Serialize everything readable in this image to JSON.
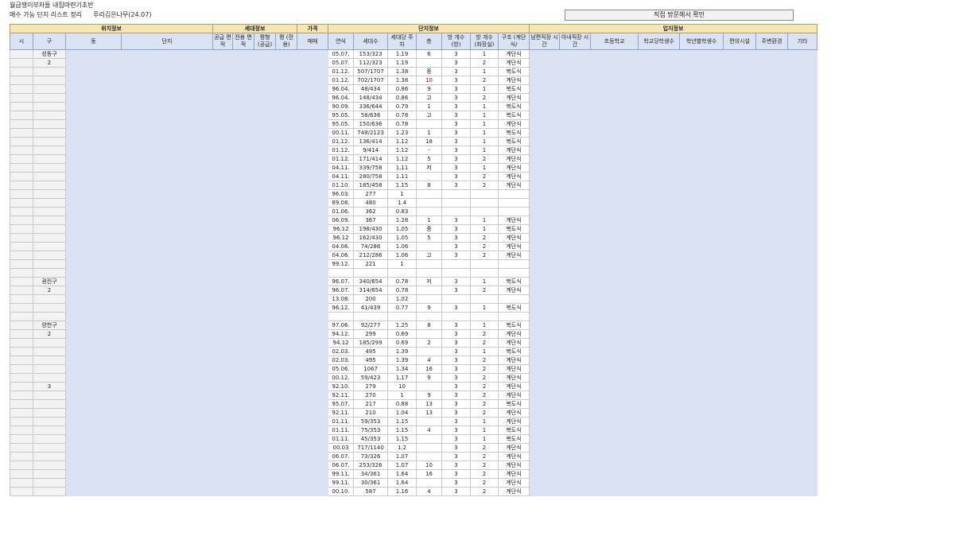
{
  "header": {
    "title": "월급쟁이부자들 내집마련기초반",
    "subtitle": "매수 가능 단지 리스트 정리",
    "author": "푸리김은나무(24.07)",
    "note": "직접 방문해서 확인"
  },
  "groups": [
    "위치정보",
    "세대정보",
    "가격",
    "단지정보",
    "입지정보"
  ],
  "columns": [
    "시",
    "구",
    "동",
    "단지",
    "공급 면적",
    "전용 면적",
    "평형 (공급)",
    "평 (전용)",
    "매매",
    "연식",
    "세대수",
    "세대당 주차",
    "층",
    "방 개수 (방)",
    "방 개수 (화장실)",
    "구조 (계단식/",
    "남편직장 시간",
    "아내직장 시간",
    "초등학교",
    "학교당학생수",
    "학년별학생수",
    "편의시설",
    "주변환경",
    "기타"
  ],
  "rows": [
    {
      "gu": "성동구",
      "year": "05.07.",
      "units": "153/323",
      "parking": "1.19",
      "floor": "6",
      "rooms": "3",
      "baths": "1",
      "structure": "계단식"
    },
    {
      "gu": "2",
      "year": "05.07.",
      "units": "112/323",
      "parking": "1.19",
      "floor": "",
      "rooms": "3",
      "baths": "2",
      "structure": "계단식"
    },
    {
      "gu": "",
      "year": "01.12.",
      "units": "507/1707",
      "parking": "1.38",
      "floor": "중",
      "rooms": "3",
      "baths": "1",
      "structure": "복도식"
    },
    {
      "gu": "",
      "year": "01.12.",
      "units": "702/1707",
      "parking": "1.38",
      "floor": "10",
      "rooms": "3",
      "baths": "2",
      "structure": "계단식",
      "red": true
    },
    {
      "gu": "",
      "year": "96.04.",
      "units": "48/434",
      "parking": "0.86",
      "floor": "9",
      "rooms": "3",
      "baths": "1",
      "structure": "복도식"
    },
    {
      "gu": "",
      "year": "96.04.",
      "units": "148/434",
      "parking": "0.86",
      "floor": "고",
      "rooms": "3",
      "baths": "2",
      "structure": "계단식"
    },
    {
      "gu": "",
      "year": "90.09.",
      "units": "336/644",
      "parking": "0.79",
      "floor": "1",
      "rooms": "3",
      "baths": "1",
      "structure": "복도식"
    },
    {
      "gu": "",
      "year": "95.05.",
      "units": "58/636",
      "parking": "0.78",
      "floor": "고",
      "rooms": "3",
      "baths": "1",
      "structure": "복도식"
    },
    {
      "gu": "",
      "year": "95.05.",
      "units": "150/636",
      "parking": "0.78",
      "floor": "",
      "rooms": "3",
      "baths": "1",
      "structure": "계단식"
    },
    {
      "gu": "",
      "year": "00.11.",
      "units": "748/2123",
      "parking": "1.23",
      "floor": "1",
      "rooms": "3",
      "baths": "1",
      "structure": "복도식"
    },
    {
      "gu": "",
      "year": "01.12.",
      "units": "136/414",
      "parking": "1.12",
      "floor": "18",
      "rooms": "3",
      "baths": "1",
      "structure": "복도식"
    },
    {
      "gu": "",
      "year": "01.12.",
      "units": "9/414",
      "parking": "1.12",
      "floor": "-",
      "rooms": "3",
      "baths": "1",
      "structure": "계단식"
    },
    {
      "gu": "",
      "year": "01.12.",
      "units": "171/414",
      "parking": "1.12",
      "floor": "5",
      "rooms": "3",
      "baths": "2",
      "structure": "계단식"
    },
    {
      "gu": "",
      "year": "04.11.",
      "units": "339/758",
      "parking": "1.11",
      "floor": "저",
      "rooms": "3",
      "baths": "1",
      "structure": "계단식"
    },
    {
      "gu": "",
      "year": "04.11.",
      "units": "280/758",
      "parking": "1.11",
      "floor": "",
      "rooms": "3",
      "baths": "2",
      "structure": "계단식"
    },
    {
      "gu": "",
      "year": "01.10.",
      "units": "185/458",
      "parking": "1.15",
      "floor": "8",
      "rooms": "3",
      "baths": "2",
      "structure": "계단식"
    },
    {
      "gu": "",
      "year": "96.03.",
      "units": "277",
      "parking": "1",
      "floor": "",
      "rooms": "",
      "baths": "",
      "structure": ""
    },
    {
      "gu": "",
      "year": "89.08.",
      "units": "480",
      "parking": "1.4",
      "floor": "",
      "rooms": "",
      "baths": "",
      "structure": ""
    },
    {
      "gu": "",
      "year": "01.06.",
      "units": "362",
      "parking": "0.83",
      "floor": "",
      "rooms": "",
      "baths": "",
      "structure": ""
    },
    {
      "gu": "",
      "year": "06.09.",
      "units": "367",
      "parking": "1.28",
      "floor": "1",
      "rooms": "3",
      "baths": "1",
      "structure": "계단식"
    },
    {
      "gu": "",
      "year": "96.12",
      "units": "198/430",
      "parking": "1.05",
      "floor": "중",
      "rooms": "3",
      "baths": "1",
      "structure": "복도식"
    },
    {
      "gu": "",
      "year": "96.12",
      "units": "162/430",
      "parking": "1.05",
      "floor": "5",
      "rooms": "3",
      "baths": "2",
      "structure": "계단식"
    },
    {
      "gu": "",
      "year": "04.06.",
      "units": "74/286",
      "parking": "1.06",
      "floor": "",
      "rooms": "3",
      "baths": "2",
      "structure": "계단식"
    },
    {
      "gu": "",
      "year": "04.06.",
      "units": "212/286",
      "parking": "1.06",
      "floor": "고",
      "rooms": "3",
      "baths": "2",
      "structure": "계단식"
    },
    {
      "gu": "",
      "year": "99.12.",
      "units": "221",
      "parking": "1",
      "floor": "",
      "rooms": "",
      "baths": "",
      "structure": ""
    },
    {
      "gu": "",
      "year": "",
      "units": "",
      "parking": "",
      "floor": "",
      "rooms": "",
      "baths": "",
      "structure": ""
    },
    {
      "gu": "광진구",
      "year": "96.07.",
      "units": "340/654",
      "parking": "0.78",
      "floor": "저",
      "rooms": "3",
      "baths": "1",
      "structure": "복도식"
    },
    {
      "gu": "2",
      "year": "96.07.",
      "units": "314/654",
      "parking": "0.78",
      "floor": "",
      "rooms": "3",
      "baths": "2",
      "structure": "계단식"
    },
    {
      "gu": "",
      "year": "13.08.",
      "units": "200",
      "parking": "1.02",
      "floor": "",
      "rooms": "",
      "baths": "",
      "structure": ""
    },
    {
      "gu": "",
      "year": "96.12.",
      "units": "41/439",
      "parking": "0.77",
      "floor": "9",
      "rooms": "3",
      "baths": "1",
      "structure": "복도식"
    },
    {
      "gu": "",
      "year": "",
      "units": "",
      "parking": "",
      "floor": "",
      "rooms": "",
      "baths": "",
      "structure": ""
    },
    {
      "gu": "양천구",
      "year": "97.06.",
      "units": "92/277",
      "parking": "1.25",
      "floor": "8",
      "rooms": "3",
      "baths": "1",
      "structure": "복도식"
    },
    {
      "gu": "2",
      "year": "94.12.",
      "units": "299",
      "parking": "0.69",
      "floor": "",
      "rooms": "3",
      "baths": "2",
      "structure": "계단식"
    },
    {
      "gu": "",
      "year": "94.12",
      "units": "185/299",
      "parking": "0.69",
      "floor": "2",
      "rooms": "3",
      "baths": "2",
      "structure": "계단식"
    },
    {
      "gu": "",
      "year": "02.03.",
      "units": "495",
      "parking": "1.39",
      "floor": "",
      "rooms": "3",
      "baths": "1",
      "structure": "복도식"
    },
    {
      "gu": "",
      "year": "02.03.",
      "units": "495",
      "parking": "1.39",
      "floor": "4",
      "rooms": "3",
      "baths": "2",
      "structure": "계단식"
    },
    {
      "gu": "",
      "year": "05.06.",
      "units": "1067",
      "parking": "1.34",
      "floor": "16",
      "rooms": "3",
      "baths": "2",
      "structure": "계단식"
    },
    {
      "gu": "",
      "year": "00.12.",
      "units": "59/423",
      "parking": "1.17",
      "floor": "9",
      "rooms": "3",
      "baths": "2",
      "structure": "계단식"
    },
    {
      "gu": "3",
      "year": "92.10.",
      "units": "279",
      "parking": "10",
      "floor": "",
      "rooms": "3",
      "baths": "2",
      "structure": "계단식"
    },
    {
      "gu": "",
      "year": "92.11.",
      "units": "270",
      "parking": "1",
      "floor": "9",
      "rooms": "3",
      "baths": "2",
      "structure": "계단식"
    },
    {
      "gu": "",
      "year": "95.07.",
      "units": "217",
      "parking": "0.88",
      "floor": "13",
      "rooms": "3",
      "baths": "2",
      "structure": "복도식"
    },
    {
      "gu": "",
      "year": "92.11.",
      "units": "210",
      "parking": "1.04",
      "floor": "13",
      "rooms": "3",
      "baths": "2",
      "structure": "계단식"
    },
    {
      "gu": "",
      "year": "01.11.",
      "units": "59/353",
      "parking": "1.15",
      "floor": "",
      "rooms": "3",
      "baths": "1",
      "structure": "계단식"
    },
    {
      "gu": "",
      "year": "01.11.",
      "units": "75/353",
      "parking": "1.15",
      "floor": "4",
      "rooms": "3",
      "baths": "1",
      "structure": "복도식"
    },
    {
      "gu": "",
      "year": "01.11.",
      "units": "45/353",
      "parking": "1.15",
      "floor": "",
      "rooms": "3",
      "baths": "1",
      "structure": "복도식"
    },
    {
      "gu": "",
      "year": "00.03",
      "units": "717/1140",
      "parking": "1.2",
      "floor": "",
      "rooms": "3",
      "baths": "2",
      "structure": "계단식"
    },
    {
      "gu": "",
      "year": "06.07.",
      "units": "73/326",
      "parking": "1.07",
      "floor": "",
      "rooms": "3",
      "baths": "2",
      "structure": "계단식"
    },
    {
      "gu": "",
      "year": "06.07.",
      "units": "253/326",
      "parking": "1.07",
      "floor": "10",
      "rooms": "3",
      "baths": "2",
      "structure": "계단식"
    },
    {
      "gu": "",
      "year": "99.11.",
      "units": "34/361",
      "parking": "1.64",
      "floor": "16",
      "rooms": "3",
      "baths": "2",
      "structure": "계단식"
    },
    {
      "gu": "",
      "year": "99.11.",
      "units": "30/361",
      "parking": "1.64",
      "floor": "",
      "rooms": "3",
      "baths": "2",
      "structure": "계단식"
    },
    {
      "gu": "",
      "year": "00.10.",
      "units": "587",
      "parking": "1.16",
      "floor": "4",
      "rooms": "3",
      "baths": "2",
      "structure": "계단식"
    }
  ]
}
